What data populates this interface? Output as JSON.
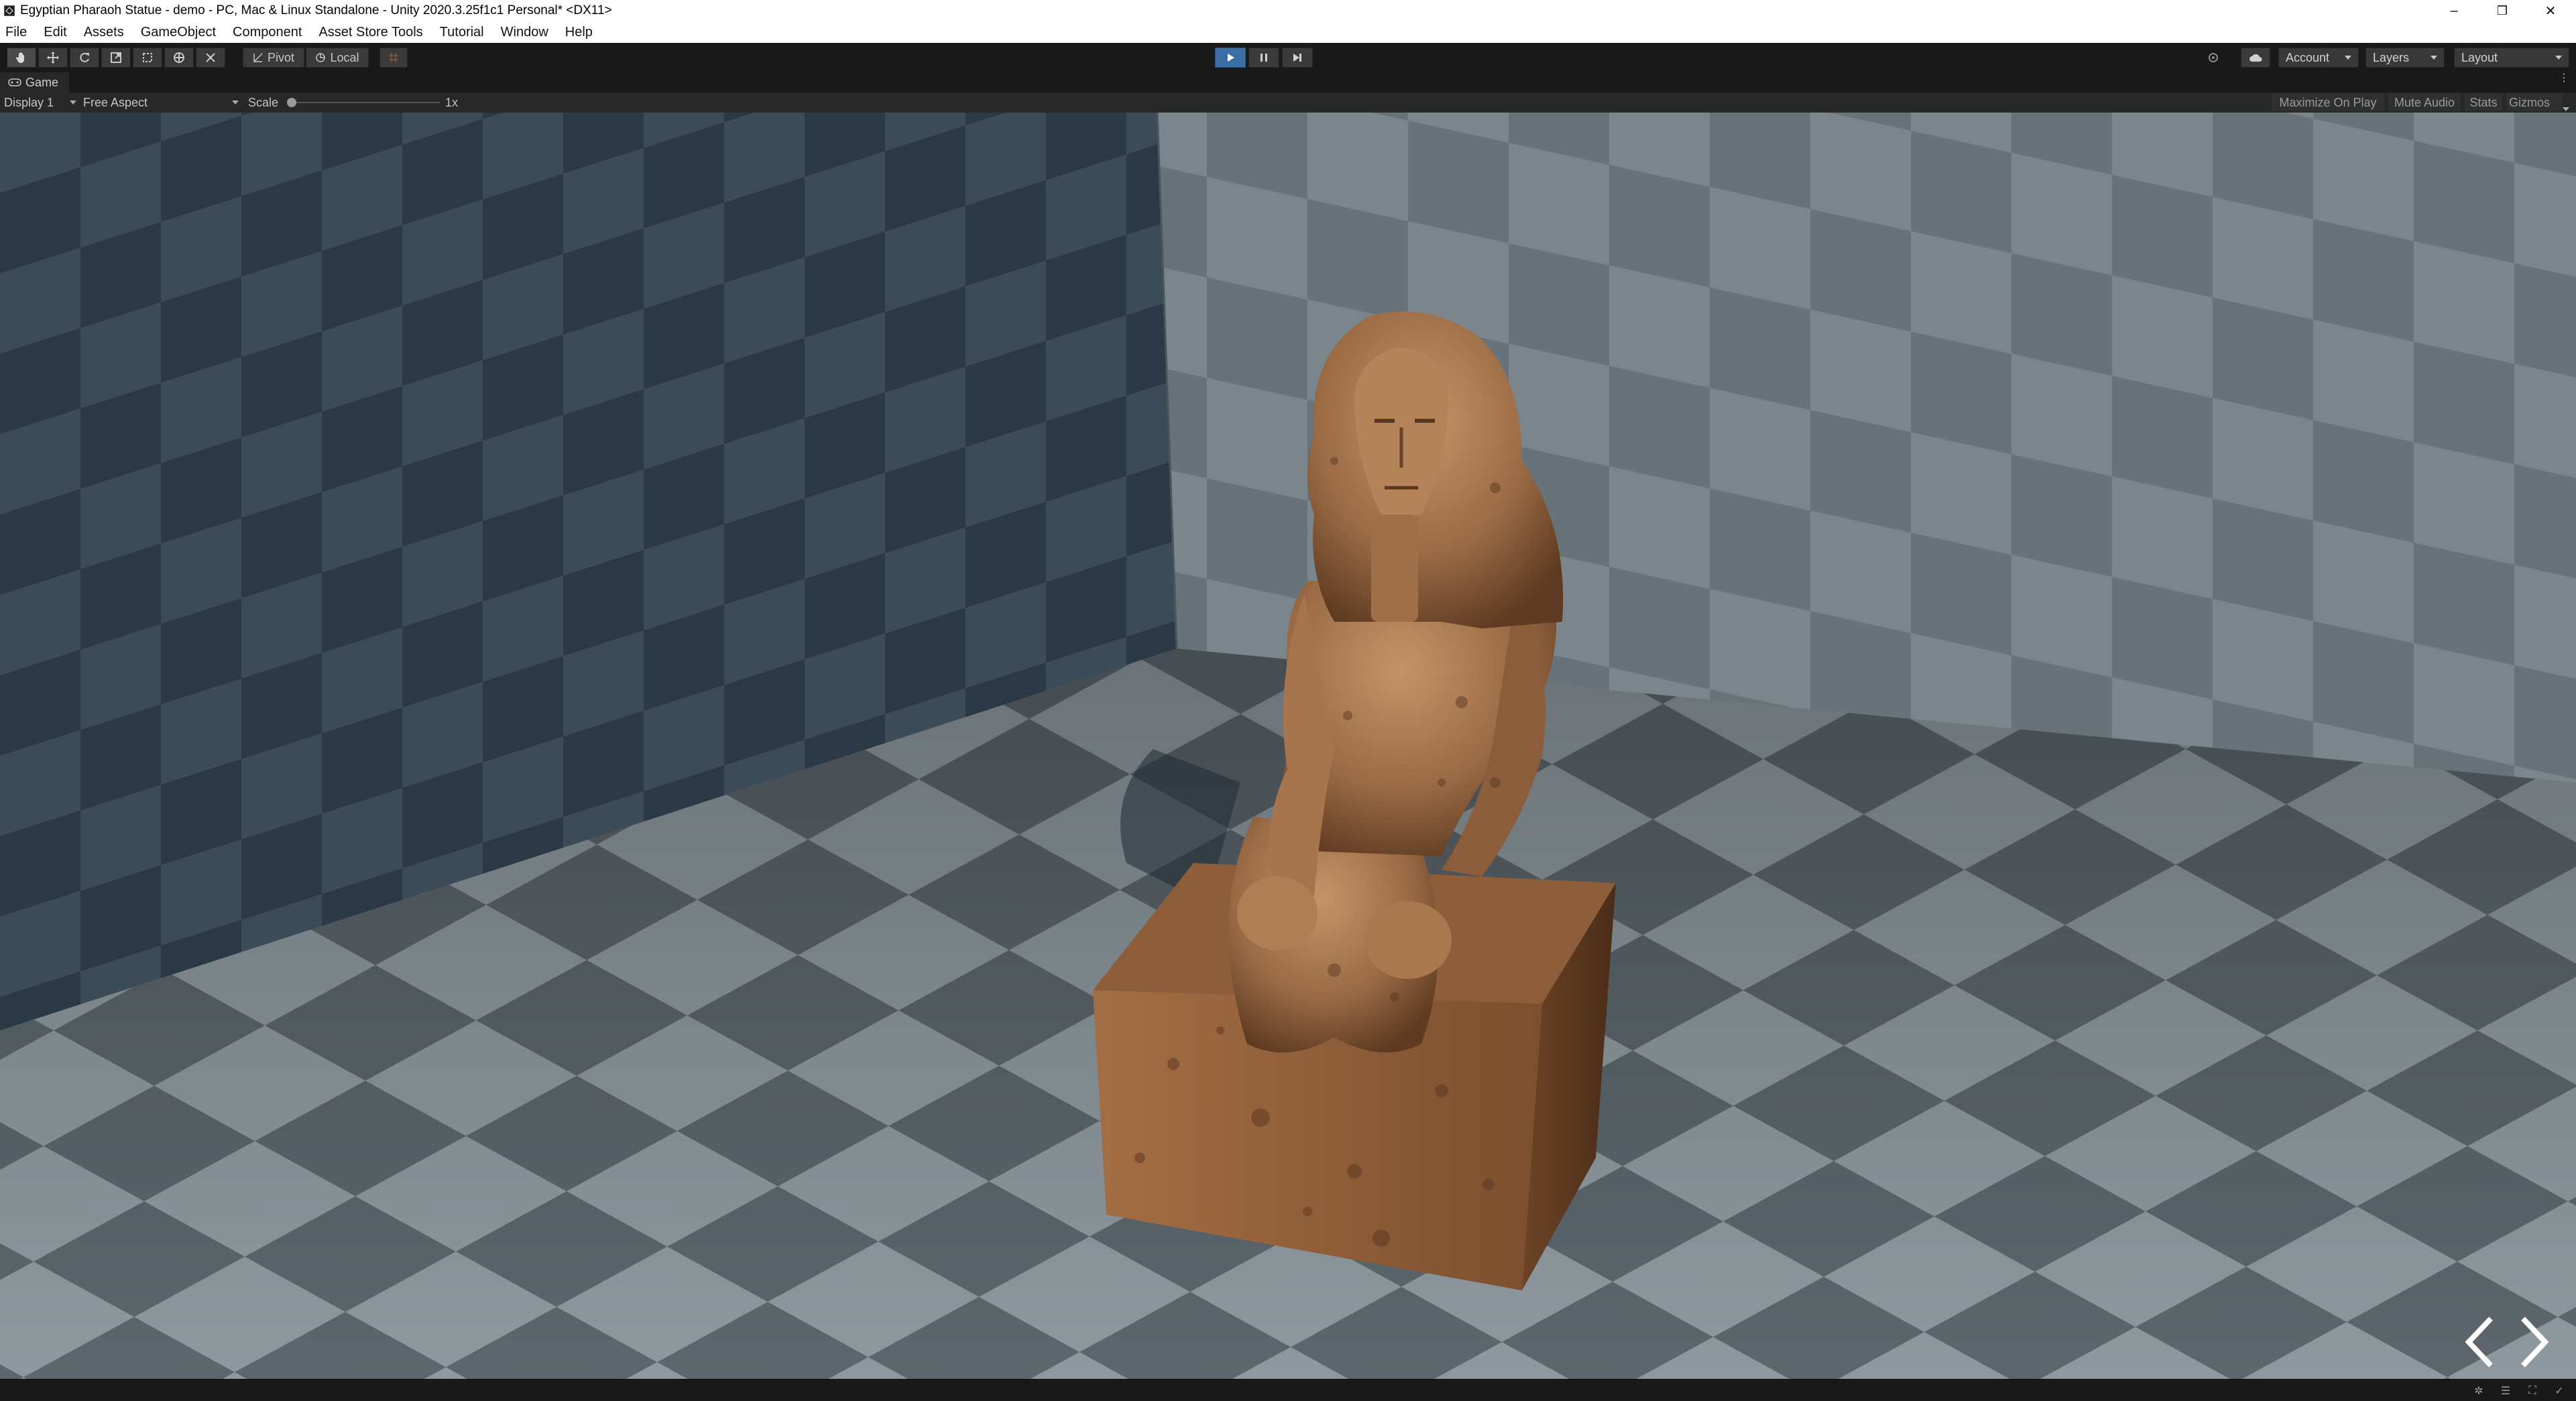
{
  "window": {
    "title": "Egyptian Pharaoh Statue - demo - PC, Mac & Linux Standalone - Unity 2020.3.25f1c1 Personal* <DX11>",
    "controls": {
      "minimize": "–",
      "maximize": "❐",
      "close": "✕"
    }
  },
  "menu": [
    "File",
    "Edit",
    "Assets",
    "GameObject",
    "Component",
    "Asset Store Tools",
    "Tutorial",
    "Window",
    "Help"
  ],
  "toolbar": {
    "tools": [
      "hand-tool-icon",
      "move-tool-icon",
      "rotate-tool-icon",
      "scale-tool-icon",
      "rect-tool-icon",
      "transform-tool-icon",
      "custom-tool-icon"
    ],
    "pivot_label": "Pivot",
    "local_label": "Local",
    "account_label": "Account",
    "layers_label": "Layers",
    "layout_label": "Layout"
  },
  "game_view": {
    "tab_label": "Game",
    "display": "Display 1",
    "aspect": "Free Aspect",
    "scale_label": "Scale",
    "scale_value": "1x",
    "scale_fraction": 0.0,
    "maximize_label": "Maximize On Play",
    "mute_label": "Mute Audio",
    "stats_label": "Stats",
    "gizmos_label": "Gizmos"
  },
  "colors": {
    "editor_bg": "#191919",
    "panel_bg": "#282828",
    "play_active": "#3a6ea5",
    "statue": "#9a6a45"
  }
}
